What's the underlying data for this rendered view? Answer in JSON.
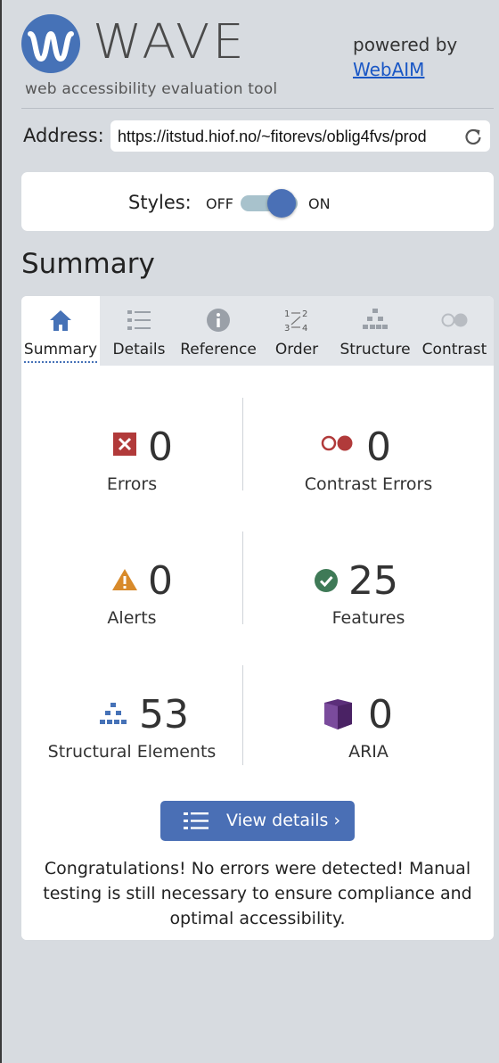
{
  "header": {
    "logo_text": "WAVE",
    "tagline": "web accessibility evaluation tool",
    "powered_by": "powered by",
    "webaim_link": "WebAIM"
  },
  "address": {
    "label": "Address:",
    "value": "https://itstud.hiof.no/~fitorevs/oblig4fvs/prod"
  },
  "styles": {
    "label": "Styles:",
    "off": "OFF",
    "on": "ON",
    "enabled": true
  },
  "summary_title": "Summary",
  "tabs": [
    {
      "label": "Summary",
      "icon": "home-icon",
      "active": true
    },
    {
      "label": "Details",
      "icon": "list-icon",
      "active": false
    },
    {
      "label": "Reference",
      "icon": "info-icon",
      "active": false
    },
    {
      "label": "Order",
      "icon": "order-icon",
      "active": false
    },
    {
      "label": "Structure",
      "icon": "structure-icon",
      "active": false
    },
    {
      "label": "Contrast",
      "icon": "contrast-icon",
      "active": false
    }
  ],
  "stats": {
    "errors": {
      "count": "0",
      "label": "Errors"
    },
    "contrast_errors": {
      "count": "0",
      "label": "Contrast Errors"
    },
    "alerts": {
      "count": "0",
      "label": "Alerts"
    },
    "features": {
      "count": "25",
      "label": "Features"
    },
    "structural": {
      "count": "53",
      "label": "Structural Elements"
    },
    "aria": {
      "count": "0",
      "label": "ARIA"
    }
  },
  "view_details_label": "View details ›",
  "congrats": "Congratulations! No errors were detected! Manual testing is still necessary to ensure compliance and optimal accessibility.",
  "colors": {
    "brand_blue": "#4672b7",
    "error_red": "#b13a3a",
    "alert_orange": "#d88a2a",
    "feature_green": "#3f7a57",
    "aria_purple": "#5b2e7a"
  }
}
